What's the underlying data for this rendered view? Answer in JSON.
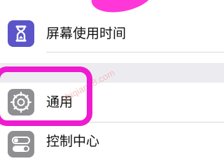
{
  "settings": {
    "rows": [
      {
        "label": "屏幕使用时间",
        "icon": "hourglass-icon",
        "color": "#5b55c9"
      },
      {
        "label": "通用",
        "icon": "gear-icon",
        "color": "#8e8e93"
      },
      {
        "label": "控制中心",
        "icon": "toggle-icon",
        "color": "#8e8e93"
      }
    ]
  },
  "watermark": "shiqian88.com",
  "colors": {
    "highlight": "#ee1bd1",
    "background_gap": "#ececf0"
  }
}
